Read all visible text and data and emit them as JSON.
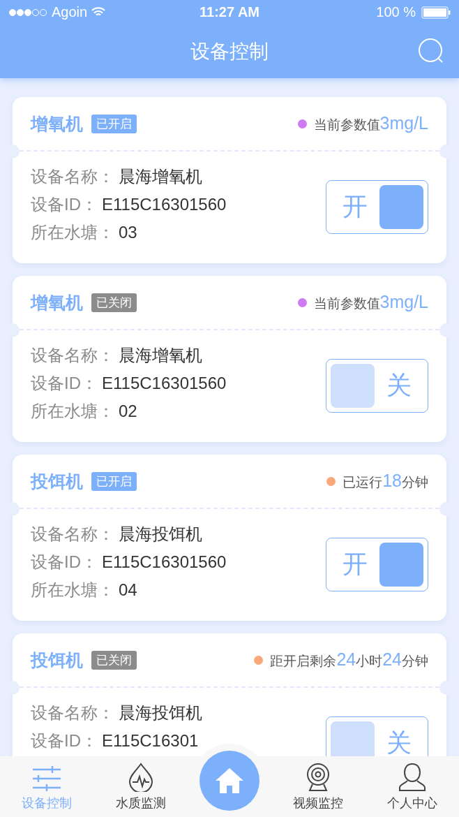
{
  "status_bar": {
    "carrier": "Agoin",
    "time": "11:27 AM",
    "battery": "100 %"
  },
  "nav": {
    "title": "设备控制"
  },
  "devices": [
    {
      "type": "增氧机",
      "status": "已开启",
      "on": true,
      "color": "#d07cf0",
      "info": [
        {
          "text": "当前参数值",
          "highlight": false
        },
        {
          "text": "3mg/L",
          "highlight": true
        }
      ],
      "fields": [
        {
          "label": "设备名称：",
          "value": "晨海增氧机"
        },
        {
          "label": "设备ID：",
          "value": "E115C16301560"
        },
        {
          "label": "所在水塘：",
          "value": "03"
        }
      ],
      "switch_label": "开"
    },
    {
      "type": "增氧机",
      "status": "已关闭",
      "on": false,
      "color": "#d07cf0",
      "info": [
        {
          "text": "当前参数值",
          "highlight": false
        },
        {
          "text": "3mg/L",
          "highlight": true
        }
      ],
      "fields": [
        {
          "label": "设备名称：",
          "value": "晨海增氧机"
        },
        {
          "label": "设备ID：",
          "value": "E115C16301560"
        },
        {
          "label": "所在水塘：",
          "value": "02"
        }
      ],
      "switch_label": "关"
    },
    {
      "type": "投饵机",
      "status": "已开启",
      "on": true,
      "color": "#f9a87a",
      "info": [
        {
          "text": "已运行",
          "highlight": false
        },
        {
          "text": "18",
          "highlight": true
        },
        {
          "text": "分钟",
          "highlight": false
        }
      ],
      "fields": [
        {
          "label": "设备名称：",
          "value": "晨海投饵机"
        },
        {
          "label": "设备ID：",
          "value": "E115C16301560"
        },
        {
          "label": "所在水塘：",
          "value": "04"
        }
      ],
      "switch_label": "开"
    },
    {
      "type": "投饵机",
      "status": "已关闭",
      "on": false,
      "color": "#f9a87a",
      "info": [
        {
          "text": "距开启剩余",
          "highlight": false
        },
        {
          "text": "24",
          "highlight": true
        },
        {
          "text": "小时",
          "highlight": false
        },
        {
          "text": "24",
          "highlight": true
        },
        {
          "text": "分钟",
          "highlight": false
        }
      ],
      "fields": [
        {
          "label": "设备名称：",
          "value": "晨海投饵机"
        },
        {
          "label": "设备ID：",
          "value": "E115C16301"
        }
      ],
      "switch_label": "关"
    }
  ],
  "tabs": [
    {
      "label": "设备控制",
      "selected": true
    },
    {
      "label": "水质监测",
      "selected": false
    },
    {
      "label": "视频监控",
      "selected": false
    },
    {
      "label": "个人中心",
      "selected": false
    }
  ]
}
